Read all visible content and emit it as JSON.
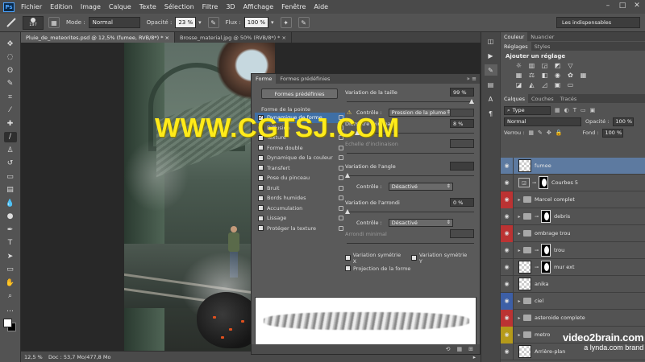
{
  "menubar": {
    "logo": "Ps",
    "items": [
      "Fichier",
      "Edition",
      "Image",
      "Calque",
      "Texte",
      "Sélection",
      "Filtre",
      "3D",
      "Affichage",
      "Fenêtre",
      "Aide"
    ]
  },
  "options": {
    "brush_size": "197",
    "mode_label": "Mode :",
    "mode_value": "Normal",
    "opacity_label": "Opacité :",
    "opacity_value": "23 %",
    "flow_label": "Flux :",
    "flow_value": "100 %",
    "workspace": "Les indispensables"
  },
  "doc_tabs": [
    {
      "label": "Pluie_de_meteorites.psd @ 12,5% (fumee, RVB/8*) *  ×",
      "active": true
    },
    {
      "label": "Brosse_material.jpg @ 50% (RVB/8*) *  ×",
      "active": false
    }
  ],
  "watermark": "WWW.CGTSJ.COM",
  "status": {
    "zoom": "12,5 %",
    "doc": "Doc : 53,7 Mo/477,8 Mo"
  },
  "brush_panel": {
    "tabs": [
      "Forme",
      "Formes prédéfinies"
    ],
    "preset_button": "Formes prédéfinies",
    "section": "Forme de la pointe",
    "items": [
      {
        "label": "Dynamique de forme",
        "checked": true,
        "selected": true
      },
      {
        "label": "Diffusion",
        "checked": true,
        "selected": false
      },
      {
        "label": "Texture",
        "checked": false,
        "selected": false
      },
      {
        "label": "Forme double",
        "checked": false,
        "selected": false
      },
      {
        "label": "Dynamique de la couleur",
        "checked": false,
        "selected": false
      },
      {
        "label": "Transfert",
        "checked": false,
        "selected": false
      },
      {
        "label": "Pose du pinceau",
        "checked": false,
        "selected": false
      },
      {
        "label": "Bruit",
        "checked": false,
        "selected": false
      },
      {
        "label": "Bords humides",
        "checked": false,
        "selected": false
      },
      {
        "label": "Accumulation",
        "checked": false,
        "selected": false
      },
      {
        "label": "Lissage",
        "checked": false,
        "selected": false
      },
      {
        "label": "Protéger la texture",
        "checked": false,
        "selected": false
      }
    ],
    "size_variation_label": "Variation de la taille",
    "size_variation_value": "99 %",
    "control_label": "Contrôle :",
    "control_1": "Pression de la plume",
    "min_diameter_label": "Diamètre minimal",
    "min_diameter_value": "8 %",
    "tilt_scale_label": "Echelle d'inclinaison",
    "angle_label": "Variation de l'angle",
    "control_2": "Désactivé",
    "roundness_label": "Variation de l'arrondi",
    "roundness_value": "0 %",
    "control_3": "Désactivé",
    "min_roundness_label": "Arrondi minimal",
    "flip_x": "Variation symétrie X",
    "flip_y": "Variation symétrie Y",
    "projection": "Projection de la forme"
  },
  "right": {
    "tabs_top": [
      "Couleur",
      "Nuancier"
    ],
    "tabs_adjust": [
      "Réglages",
      "Styles"
    ],
    "adjust_title": "Ajouter un réglage",
    "tabs_layers": [
      "Calques",
      "Couches",
      "Tracés"
    ],
    "filter_type": "Type",
    "blend_mode": "Normal",
    "opacity_label": "Opacité :",
    "opacity_value": "100 %",
    "lock_label": "Verrou :",
    "fill_label": "Fond :",
    "fill_value": "100 %",
    "layers": [
      {
        "name": "fumee",
        "kind": "pixel",
        "eye": "normal",
        "selected": true
      },
      {
        "name": "Courbes 5",
        "kind": "adjust",
        "eye": "normal",
        "selected": false
      },
      {
        "name": "Marcel complet",
        "kind": "group",
        "eye": "red",
        "selected": false
      },
      {
        "name": "debris",
        "kind": "group-mask",
        "eye": "normal",
        "selected": false
      },
      {
        "name": "ombrage trou",
        "kind": "group",
        "eye": "red",
        "selected": false
      },
      {
        "name": "trou",
        "kind": "group-mask",
        "eye": "normal",
        "selected": false
      },
      {
        "name": "mur ext",
        "kind": "pixel-mask",
        "eye": "normal",
        "selected": false
      },
      {
        "name": "anika",
        "kind": "pixel",
        "eye": "normal",
        "selected": false
      },
      {
        "name": "ciel",
        "kind": "group",
        "eye": "blue",
        "selected": false
      },
      {
        "name": "asteroide complete",
        "kind": "group",
        "eye": "red",
        "selected": false
      },
      {
        "name": "metro",
        "kind": "group",
        "eye": "yellow",
        "selected": false
      },
      {
        "name": "Arrière-plan",
        "kind": "pixel",
        "eye": "normal",
        "selected": false
      }
    ]
  },
  "brand": {
    "line1": "video2brain.com",
    "line2": "a lynda.com brand"
  }
}
